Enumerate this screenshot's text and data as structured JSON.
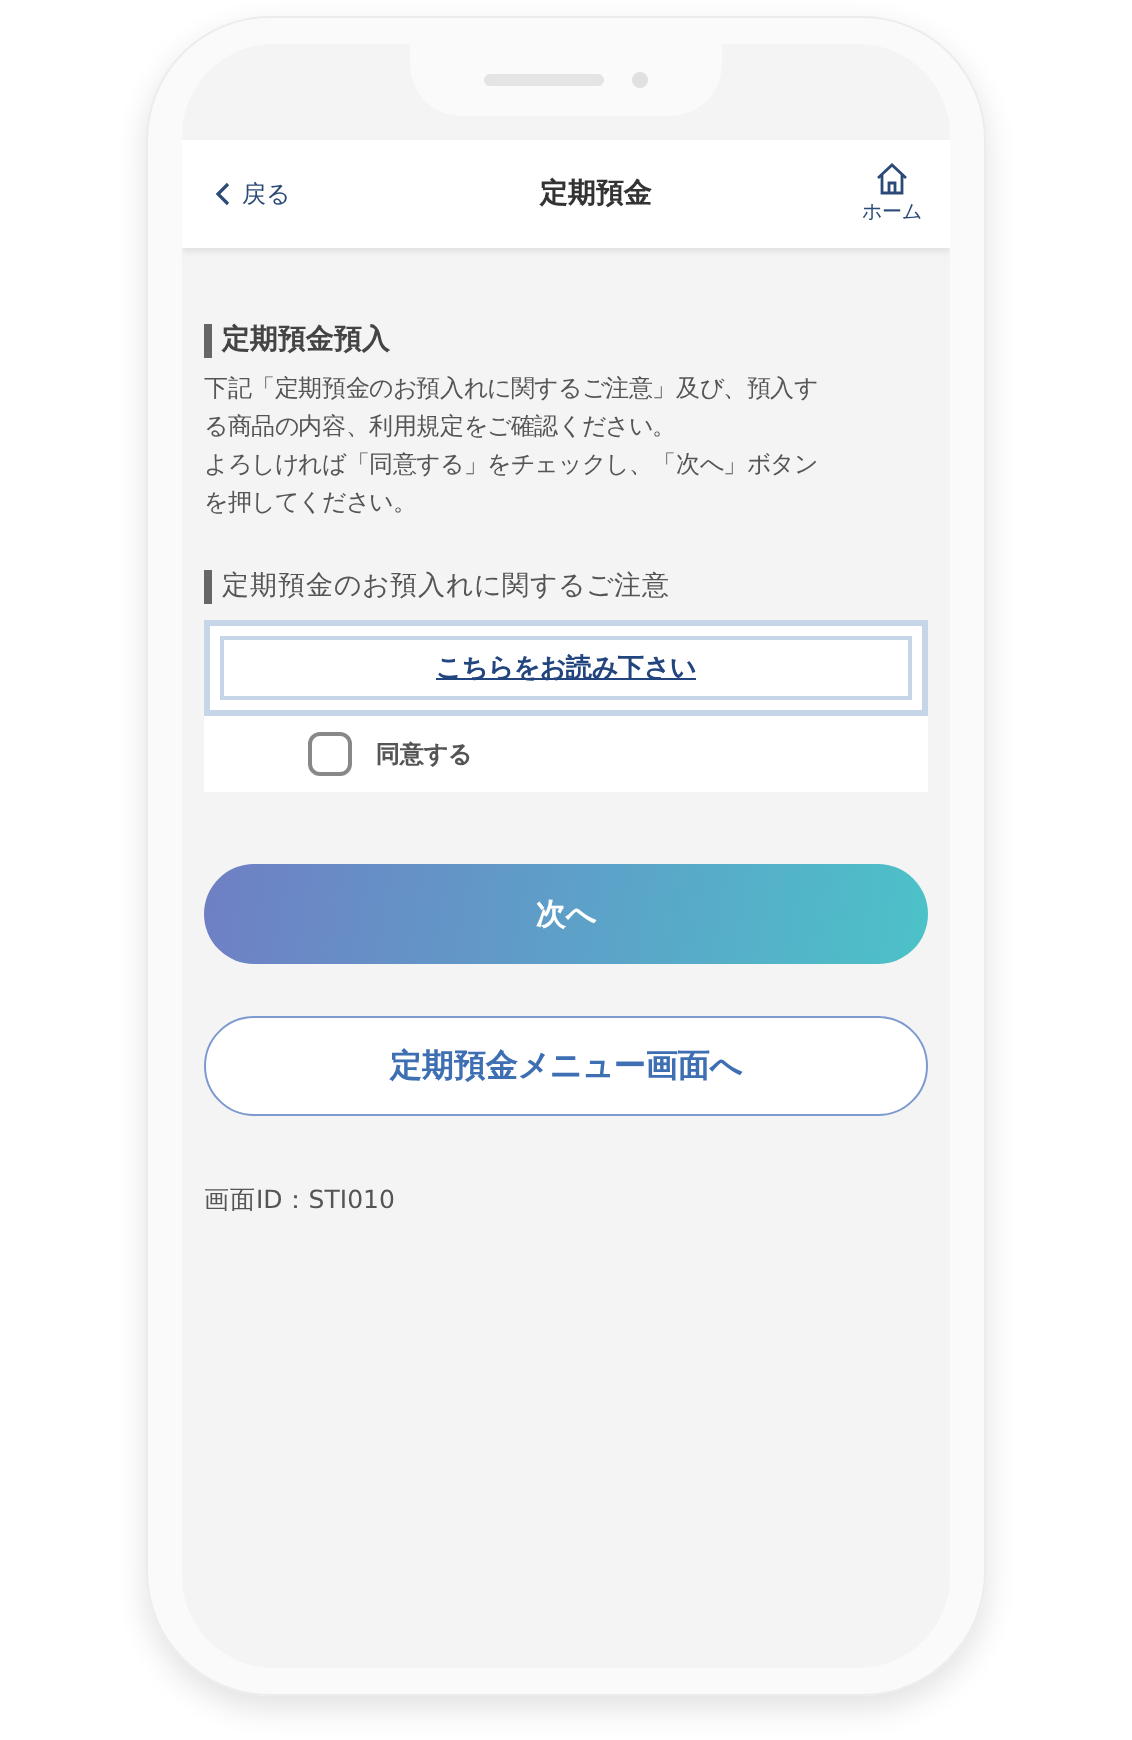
{
  "header": {
    "back": "戻る",
    "title": "定期預金",
    "home": "ホーム"
  },
  "section": {
    "heading": "定期預金預入",
    "description": [
      "下記「定期預金のお預入れに関するご注意」及び、預入す",
      "る商品の内容、利用規定をご確認ください。",
      "よろしければ「同意する」をチェックし、「次へ」ボタン",
      "を押してください。"
    ]
  },
  "notice": {
    "heading": "定期預金のお預入れに関するご注意",
    "link": "こちらをお読み下さい",
    "agree": {
      "label": "同意する",
      "checked": false
    }
  },
  "buttons": [
    {
      "kind": "primary",
      "label": "次へ"
    },
    {
      "kind": "secondary",
      "label": "定期預金メニュー画面へ"
    }
  ],
  "screen_id": "画面ID：STI010"
}
